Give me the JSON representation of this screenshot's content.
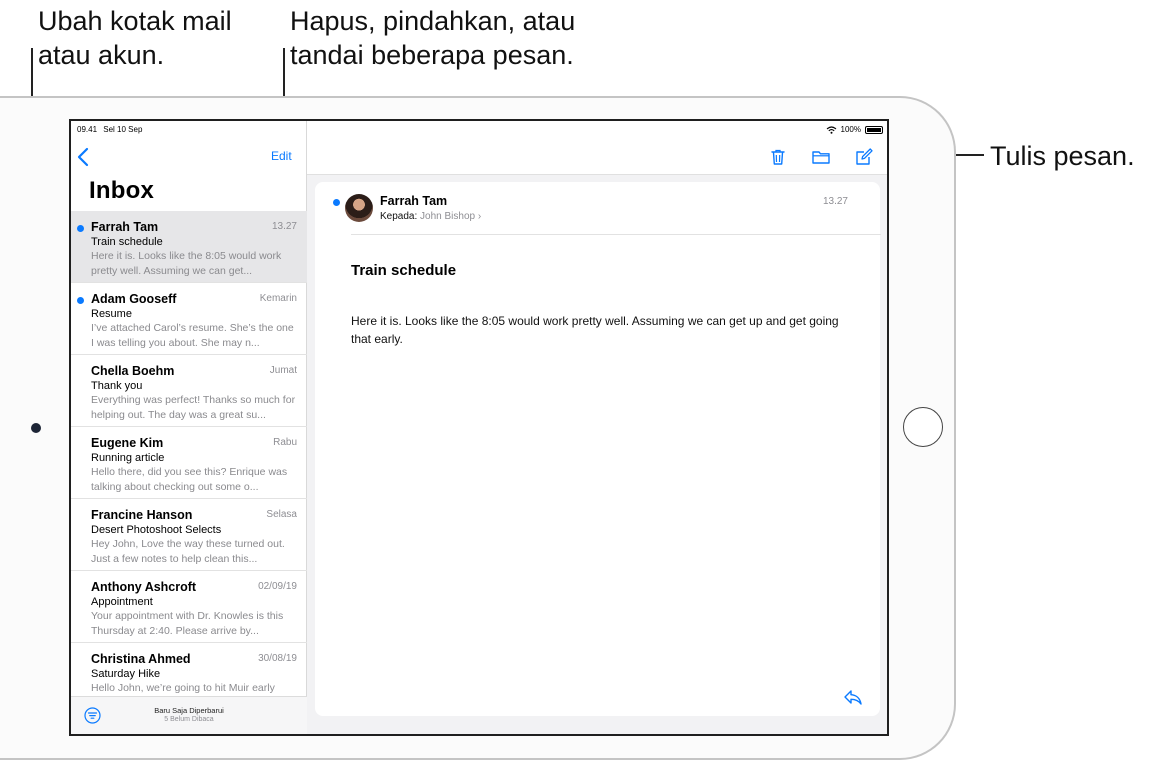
{
  "callouts": {
    "mailbox": [
      "Ubah kotak mail",
      "atau akun."
    ],
    "multi": [
      "Hapus, pindahkan, atau",
      "tandai beberapa pesan."
    ],
    "compose": "Tulis pesan."
  },
  "status": {
    "time": "09.41",
    "date": "Sel 10 Sep",
    "battery": "100%"
  },
  "left": {
    "edit_label": "Edit",
    "title": "Inbox",
    "updated": "Baru Saja Diperbarui",
    "unread": "5 Belum Dibaca"
  },
  "mails": [
    {
      "sender": "Farrah Tam",
      "date": "13.27",
      "subject": "Train schedule",
      "preview": "Here it is. Looks like the 8:05 would work pretty well. Assuming we can get...",
      "unread": true,
      "selected": true
    },
    {
      "sender": "Adam Gooseff",
      "date": "Kemarin",
      "subject": "Resume",
      "preview": "I’ve attached Carol’s resume. She’s the one I was telling you about. She may n...",
      "unread": true,
      "selected": false
    },
    {
      "sender": "Chella Boehm",
      "date": "Jumat",
      "subject": "Thank you",
      "preview": "Everything was perfect! Thanks so much for helping out. The day was a great su...",
      "unread": false,
      "selected": false
    },
    {
      "sender": "Eugene Kim",
      "date": "Rabu",
      "subject": "Running article",
      "preview": "Hello there, did you see this? Enrique was talking about checking out some o...",
      "unread": false,
      "selected": false
    },
    {
      "sender": "Francine Hanson",
      "date": "Selasa",
      "subject": "Desert Photoshoot Selects",
      "preview": "Hey John, Love the way these turned out. Just a few notes to help clean this...",
      "unread": false,
      "selected": false
    },
    {
      "sender": "Anthony Ashcroft",
      "date": "02/09/19",
      "subject": "Appointment",
      "preview": "Your appointment with Dr. Knowles is this Thursday at 2:40. Please arrive by...",
      "unread": false,
      "selected": false
    },
    {
      "sender": "Christina Ahmed",
      "date": "30/08/19",
      "subject": "Saturday Hike",
      "preview": "Hello John, we’re going to hit Muir early",
      "unread": false,
      "selected": false
    }
  ],
  "message": {
    "from": "Farrah Tam",
    "to_label": "Kepada:",
    "to_name": "John Bishop",
    "time": "13.27",
    "subject": "Train schedule",
    "body": "Here it is. Looks like the 8:05 would work pretty well. Assuming we can get up and get going that early."
  },
  "toolbar_icons": [
    "trash-icon",
    "folder-icon",
    "compose-icon"
  ],
  "colors": {
    "accent": "#0a7aff",
    "selected_row": "#e6e6e8",
    "pane_bg": "#f2f2f4"
  }
}
